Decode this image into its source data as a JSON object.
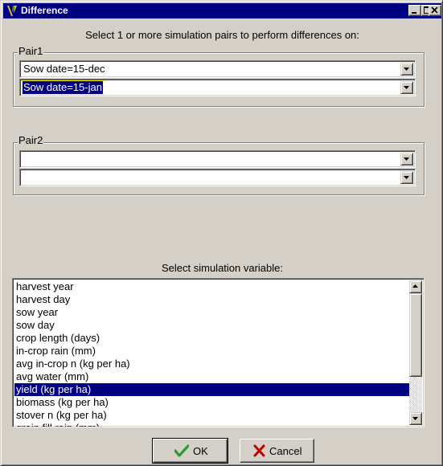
{
  "window": {
    "title": "Difference",
    "controls": {
      "minimize": "minimize",
      "maximize": "maximize",
      "close": "close"
    }
  },
  "instruction": "Select 1 or more simulation pairs to perform differences on:",
  "pairs": [
    {
      "label": "Pair1",
      "first_value": "Sow date=15-dec",
      "second_value": "Sow date=15-jan"
    },
    {
      "label": "Pair2",
      "first_value": "",
      "second_value": ""
    }
  ],
  "variable_prompt": "Select simulation variable:",
  "variables": [
    "harvest year",
    "harvest day",
    "sow year",
    "sow day",
    "crop length (days)",
    "in-crop rain (mm)",
    "avg in-crop n (kg per ha)",
    "avg water (mm)",
    "yield (kg per ha)",
    "biomass (kg per ha)",
    "stover n (kg per ha)",
    "grain fill rain (mm)"
  ],
  "selected_variable": "yield (kg per ha)",
  "buttons": {
    "ok": "OK",
    "cancel": "Cancel"
  },
  "colors": {
    "titlebar": "#000080",
    "face": "#d4d0c8",
    "selection": "#000080",
    "ok_check": "#2e9a2e",
    "cancel_x": "#c00000"
  },
  "icons": {
    "app": "apsim-app-icon",
    "ok": "check-icon",
    "cancel": "red-x-icon"
  }
}
